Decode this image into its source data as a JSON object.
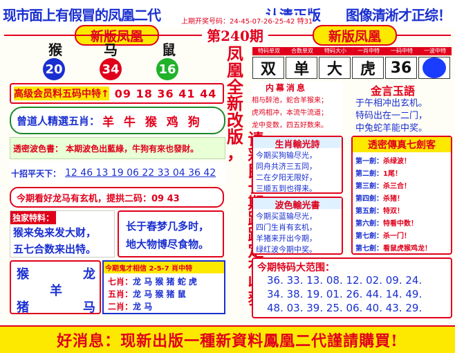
{
  "header": {
    "banner_left": "现市面上有假冒的凤凰二代",
    "banner_mid": "认清正版",
    "banner_right": "图像清淅才正综！",
    "draw_info": "上期开奖号码：24-45-07-26-25-42 特31",
    "badge_left": "新版凤凰",
    "badge_right": "新版凤凰",
    "issue": "第240期"
  },
  "zodiac_balls": [
    {
      "animal": "猴",
      "number": "20",
      "color": "#1a2fd0"
    },
    {
      "animal": "马",
      "number": "34",
      "color": "#e0001b"
    },
    {
      "animal": "鼠",
      "number": "16",
      "color": "#1fb22a"
    }
  ],
  "vertical_slogan": {
    "col1": "凤凰全新改版，",
    "col2": "请彩民长期跟踪定有收获"
  },
  "result_table": {
    "headers": [
      "特码单双",
      "合数单双",
      "特码大小",
      "一肖中特",
      "一码中特",
      "一波中特"
    ],
    "values": [
      "双",
      "单",
      "大",
      "虎",
      "36",
      ""
    ],
    "wave_color": "#1a3cff"
  },
  "rows": {
    "five_codes_label": "高级会员料五码中特↑",
    "five_codes": "09 18 36 41 44",
    "five_zodiac_label": "曾道人精選五肖：",
    "five_zodiac": "羊 牛 猴 鸡 狗",
    "wave_tip": "透密波色書： 本期波色出藍綠，牛狗有來也發財。",
    "ten_codes_label": "十招平天下：",
    "ten_codes": "12 46 13 19 06 22 33 04 36 42",
    "two_codes": "今期看好龙马有玄机，提拱二码：09 43"
  },
  "inner_news": {
    "title": "内幕消息",
    "lines": [
      "相与醉池，蛇合羊猴来；",
      "虎鸡相冲，本流牛流道；",
      "龙中变数，四五好数来。"
    ]
  },
  "golden_words": {
    "title": "金言玉語",
    "lines": [
      "于午相冲出玄机。",
      "特码出在一二门，",
      "中兔蛇羊能中奖。"
    ]
  },
  "shengxiao_poem": {
    "title": "生肖輸光詩",
    "lines": [
      "今期买狗输尽光，",
      "同舟共济三五同，",
      "二在夕阳无限好，",
      "三顺五到也得来。"
    ]
  },
  "wave_poem": {
    "title": "波色輸光書",
    "lines": [
      "今期买蓝输尽光，",
      "四门生肖有玄机，",
      "羊猪来开出今期，",
      "绿红波今期中奖。"
    ]
  },
  "seven_swords": {
    "title": "透密傳真七劍客",
    "items": [
      {
        "label": "第一劍：",
        "text": "杀绿波！"
      },
      {
        "label": "第二劍：",
        "text": "1尾！"
      },
      {
        "label": "第三劍：",
        "text": "杀三合！"
      },
      {
        "label": "第四劍：",
        "text": "杀猪！"
      },
      {
        "label": "第五劍：",
        "text": "特双！"
      },
      {
        "label": "第六劍：",
        "text": "特看中数！"
      },
      {
        "label": "第七劍：",
        "text": "杀一门！"
      },
      {
        "label": "第七劍：",
        "text": "看鼠虎猴鸡龙！"
      }
    ]
  },
  "special_info": {
    "title": "独家特料：",
    "lines": [
      "猴来兔来发大财，",
      "五七合数来出特。"
    ]
  },
  "spring_dream": {
    "lines": [
      "长于春梦几多时，",
      "地大物博尽食物。"
    ]
  },
  "four_zodiac": {
    "chars": [
      "猴",
      "龙",
      "羊",
      "猪",
      "马"
    ]
  },
  "ghost_talent": {
    "title": "今期鬼才相信 2-5-7 肖中特",
    "lines": [
      {
        "label": "七肖：",
        "text": "龙 马 猴 猪 蛇 虎"
      },
      {
        "label": "五肖：",
        "text": "龙 马 猴 猪 鼠"
      },
      {
        "label": "二肖：",
        "text": "龙 马"
      }
    ]
  },
  "big_range": {
    "title": "今期特码大范围：",
    "rows": [
      "36. 33. 13. 08. 12. 02. 09. 24.",
      "34. 38. 19. 01. 26. 44. 14. 49.",
      "48. 03. 39. 25. 06. 40. 43. 29."
    ]
  },
  "footer": {
    "text": "好消息：现新出版一種新資料鳳凰二代謹請購買!"
  }
}
